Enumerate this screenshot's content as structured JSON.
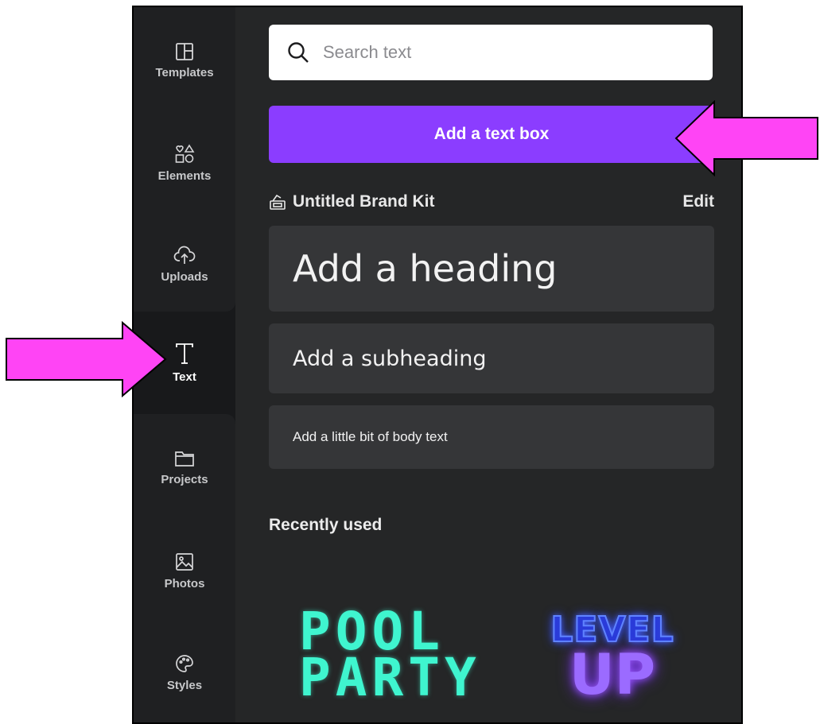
{
  "rail": {
    "items": [
      {
        "label": "Templates",
        "icon": "templates-icon"
      },
      {
        "label": "Elements",
        "icon": "elements-icon"
      },
      {
        "label": "Uploads",
        "icon": "upload-cloud-icon"
      },
      {
        "label": "Text",
        "icon": "text-icon"
      },
      {
        "label": "Projects",
        "icon": "folder-icon"
      },
      {
        "label": "Photos",
        "icon": "image-icon"
      },
      {
        "label": "Styles",
        "icon": "palette-icon"
      }
    ],
    "active": "Text"
  },
  "panel": {
    "search_placeholder": "Search text",
    "add_text_box_label": "Add a text box",
    "brand_kit_label": "Untitled Brand Kit",
    "edit_label": "Edit",
    "heading_label": "Add a heading",
    "subheading_label": "Add a subheading",
    "body_label": "Add a little bit of body text",
    "recently_used_label": "Recently used",
    "samples": [
      {
        "line1": "POOL",
        "line2": "PARTY",
        "color": "#3ff5cf"
      },
      {
        "line1": "LEVEL",
        "line2": "UP",
        "color": "#9b6bff"
      }
    ]
  },
  "colors": {
    "accent": "#8b3dff",
    "annotation_arrow": "#ff44f5",
    "panel_bg": "#252627",
    "rail_bg": "#18191b"
  }
}
